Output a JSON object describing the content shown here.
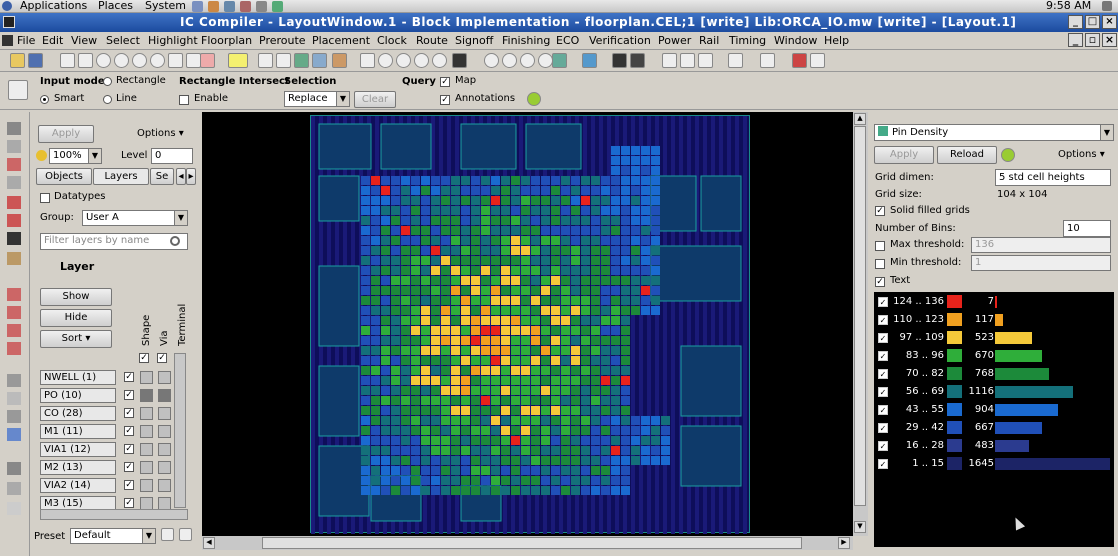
{
  "system_bar": {
    "applications": "Applications",
    "places": "Places",
    "system": "System",
    "clock": "9:58 AM"
  },
  "window": {
    "title": "IC Compiler - LayoutWindow.1 - Block Implementation - floorplan.CEL;1 [write]     Lib:ORCA_IO.mw [write] - [Layout.1]"
  },
  "menu": [
    "File",
    "Edit",
    "View",
    "Select",
    "Highlight",
    "Floorplan",
    "Preroute",
    "Placement",
    "Clock",
    "Route",
    "Signoff",
    "Finishing",
    "ECO",
    "Verification",
    "Power",
    "Rail",
    "Timing",
    "Window",
    "Help"
  ],
  "options": {
    "input_mode_label": "Input mode",
    "rectangle": "Rectangle",
    "smart": "Smart",
    "line": "Line",
    "rect_intersect_label": "Rectangle Intersect",
    "enable": "Enable",
    "selection_label": "Selection",
    "selection_value": "Replace",
    "clear": "Clear",
    "query_label": "Query",
    "map": "Map",
    "annotations": "Annotations"
  },
  "layers_panel": {
    "apply": "Apply",
    "options": "Options",
    "zoom": "100%",
    "level_label": "Level",
    "level_value": "0",
    "tab_objects": "Objects",
    "tab_layers": "Layers",
    "tab_more": "Se",
    "datatypes": "Datatypes",
    "group_label": "Group:",
    "group_value": "User A",
    "filter_placeholder": "Filter layers by name",
    "layer_header": "Layer",
    "show": "Show",
    "hide": "Hide",
    "sort": "Sort",
    "col_shape": "Shape",
    "col_via": "Via",
    "col_terminal": "Terminal",
    "layers": [
      "NWELL (1)",
      "PO (10)",
      "CO (28)",
      "M1 (11)",
      "VIA1 (12)",
      "M2 (13)",
      "VIA2 (14)",
      "M3 (15)"
    ],
    "preset_label": "Preset",
    "preset_value": "Default"
  },
  "map_panel": {
    "map_type": "Pin Density",
    "apply": "Apply",
    "reload": "Reload",
    "options": "Options",
    "grid_dimen_label": "Grid dimen:",
    "grid_dimen_value": "5 std cell heights",
    "grid_size_label": "Grid size:",
    "grid_size_value": "104 x 104",
    "solid_filled": "Solid filled grids",
    "bins_label": "Number of Bins:",
    "bins_value": "10",
    "max_threshold_label": "Max threshold:",
    "max_threshold_value": "136",
    "min_threshold_label": "Min threshold:",
    "min_threshold_value": "1",
    "text_label": "Text",
    "bins": [
      {
        "range": "124 .. 136",
        "count": "7",
        "n": 7,
        "color": "#e8231b"
      },
      {
        "range": "110 .. 123",
        "count": "117",
        "n": 117,
        "color": "#f0a020"
      },
      {
        "range": "97 .. 109",
        "count": "523",
        "n": 523,
        "color": "#f5c93a"
      },
      {
        "range": "83 .. 96",
        "count": "670",
        "n": 670,
        "color": "#2fae3a"
      },
      {
        "range": "70 .. 82",
        "count": "768",
        "n": 768,
        "color": "#1c8a3a"
      },
      {
        "range": "56 .. 69",
        "count": "1116",
        "n": 1116,
        "color": "#14707a"
      },
      {
        "range": "43 .. 55",
        "count": "904",
        "n": 904,
        "color": "#1a6ad0"
      },
      {
        "range": "29 .. 42",
        "count": "667",
        "n": 667,
        "color": "#2050b8"
      },
      {
        "range": "16 .. 28",
        "count": "483",
        "n": 483,
        "color": "#2b3b8f"
      },
      {
        "range": "1 .. 15",
        "count": "1645",
        "n": 1645,
        "color": "#1c2466"
      }
    ]
  }
}
